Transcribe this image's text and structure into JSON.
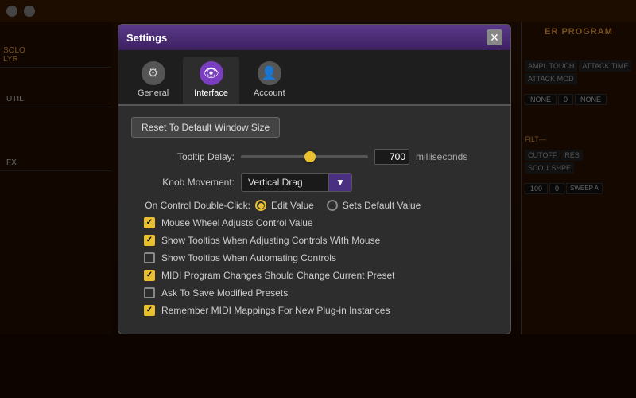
{
  "bg": {
    "title": "Settings",
    "right_panel_title": "ER PROGRAM",
    "circles": [
      "●",
      "●"
    ]
  },
  "dialog": {
    "title": "Settings",
    "close_label": "✕",
    "tabs": [
      {
        "id": "general",
        "label": "General",
        "icon": "⚙",
        "active": false
      },
      {
        "id": "interface",
        "label": "Interface",
        "icon": "👁",
        "active": true
      },
      {
        "id": "account",
        "label": "Account",
        "icon": "👤",
        "active": false
      }
    ],
    "body": {
      "reset_button": "Reset To Default Window Size",
      "tooltip_delay_label": "Tooltip Delay:",
      "tooltip_delay_value": "700",
      "tooltip_delay_ms": "milliseconds",
      "knob_movement_label": "Knob Movement:",
      "knob_movement_value": "Vertical Drag",
      "on_control_label": "On Control Double-Click:",
      "radio_edit": "Edit Value",
      "radio_default": "Sets Default Value",
      "checkboxes": [
        {
          "id": "mouse_wheel",
          "label": "Mouse Wheel Adjusts Control Value",
          "checked": true
        },
        {
          "id": "show_tooltips_adjusting",
          "label": "Show Tooltips When Adjusting Controls With Mouse",
          "checked": true
        },
        {
          "id": "show_tooltips_automating",
          "label": "Show Tooltips When Automating Controls",
          "checked": false
        },
        {
          "id": "midi_program",
          "label": "MIDI Program Changes Should Change Current Preset",
          "checked": true
        },
        {
          "id": "ask_save",
          "label": "Ask To Save Modified Presets",
          "checked": false
        },
        {
          "id": "remember_midi",
          "label": "Remember MIDI Mappings For New Plug-in Instances",
          "checked": true
        }
      ]
    }
  }
}
